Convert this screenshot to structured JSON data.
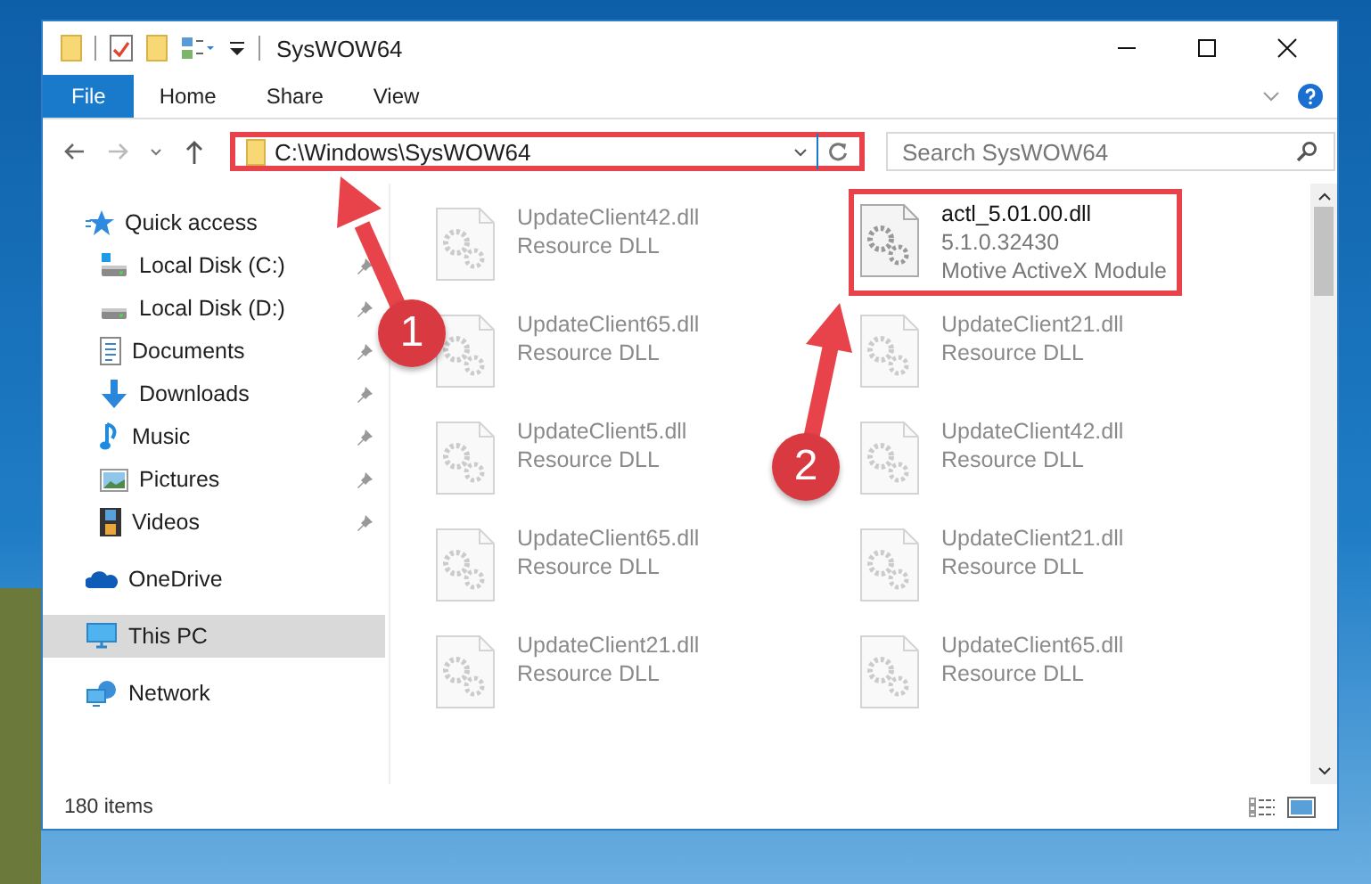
{
  "window": {
    "title": "SysWOW64"
  },
  "ribbon_tabs": [
    {
      "label": "File",
      "selected": true
    },
    {
      "label": "Home",
      "selected": false
    },
    {
      "label": "Share",
      "selected": false
    },
    {
      "label": "View",
      "selected": false
    }
  ],
  "address_bar": {
    "path": "C:\\Windows\\SysWOW64",
    "highlighted": true
  },
  "search": {
    "placeholder": "Search SysWOW64"
  },
  "sidebar": {
    "items": [
      {
        "label": "Quick access",
        "kind": "star",
        "selected": false,
        "children": [
          {
            "label": "Local Disk (C:)",
            "kind": "system-drive",
            "pinned": true,
            "selected": false
          },
          {
            "label": "Local Disk (D:)",
            "kind": "drive",
            "pinned": true,
            "selected": false
          },
          {
            "label": "Documents",
            "kind": "document",
            "pinned": true,
            "selected": false
          },
          {
            "label": "Downloads",
            "kind": "download",
            "pinned": true,
            "selected": false
          },
          {
            "label": "Music",
            "kind": "music",
            "pinned": true,
            "selected": false
          },
          {
            "label": "Pictures",
            "kind": "picture",
            "pinned": true,
            "selected": false
          },
          {
            "label": "Videos",
            "kind": "video",
            "pinned": true,
            "selected": false
          }
        ]
      },
      {
        "label": "OneDrive",
        "kind": "cloud",
        "selected": false
      },
      {
        "label": "This PC",
        "kind": "computer",
        "selected": true
      },
      {
        "label": "Network",
        "kind": "network",
        "selected": false
      }
    ]
  },
  "files": [
    {
      "name": "UpdateClient42.dll",
      "details": [
        "Resource DLL"
      ],
      "blurred": true,
      "highlighted": false
    },
    {
      "name": "actl_5.01.00.dll",
      "details": [
        "5.1.0.32430",
        "Motive ActiveX Module"
      ],
      "blurred": false,
      "highlighted": true
    },
    {
      "name": "UpdateClient65.dll",
      "details": [
        "Resource DLL"
      ],
      "blurred": true,
      "highlighted": false
    },
    {
      "name": "UpdateClient21.dll",
      "details": [
        "Resource DLL"
      ],
      "blurred": true,
      "highlighted": false
    },
    {
      "name": "UpdateClient5.dll",
      "details": [
        "Resource DLL"
      ],
      "blurred": true,
      "highlighted": false
    },
    {
      "name": "UpdateClient42.dll",
      "details": [
        "Resource DLL"
      ],
      "blurred": true,
      "highlighted": false
    },
    {
      "name": "UpdateClient65.dll",
      "details": [
        "Resource DLL"
      ],
      "blurred": true,
      "highlighted": false
    },
    {
      "name": "UpdateClient21.dll",
      "details": [
        "Resource DLL"
      ],
      "blurred": true,
      "highlighted": false
    },
    {
      "name": "UpdateClient21.dll",
      "details": [
        "Resource DLL"
      ],
      "blurred": true,
      "highlighted": false
    },
    {
      "name": "UpdateClient65.dll",
      "details": [
        "Resource DLL"
      ],
      "blurred": true,
      "highlighted": false
    }
  ],
  "annotations": [
    {
      "label": "1"
    },
    {
      "label": "2"
    }
  ],
  "status_bar": {
    "item_count": "180 items"
  }
}
